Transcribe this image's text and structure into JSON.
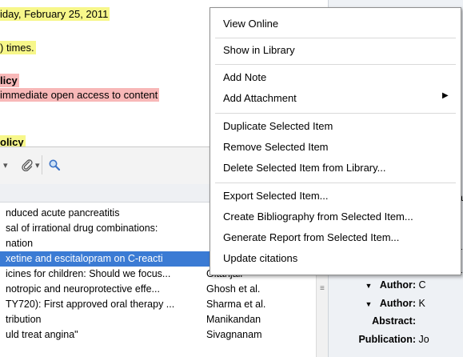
{
  "document": {
    "lines": [
      {
        "text": "iday, February 25, 2011",
        "style": "yellow"
      },
      {
        "text": ") times.",
        "style": "yellow"
      },
      {
        "text": "licy",
        "style": "pink-bold"
      },
      {
        "text": "immediate open access to content",
        "style": "pink"
      },
      {
        "text": "olicy",
        "style": "yellow-bold"
      }
    ]
  },
  "toolbar": {
    "attach_icon": "paperclip-icon",
    "search_icon": "magnifier-icon"
  },
  "items": [
    {
      "title": "nduced acute pancreatitis",
      "creator": ""
    },
    {
      "title": "sal of irrational drug combinations:",
      "creator": ""
    },
    {
      "title": "nation",
      "creator": ""
    },
    {
      "title": "xetine and escitalopram on C-reacti",
      "creator": "",
      "selected": true
    },
    {
      "title": "icines for children: Should we focus...",
      "creator": "Gitanjali"
    },
    {
      "title": "notropic and neuroprotective effe...",
      "creator": "Ghosh et al."
    },
    {
      "title": "TY720): First approved oral therapy ...",
      "creator": "Sharma et al."
    },
    {
      "title": "tribution",
      "creator": "Manikandan"
    },
    {
      "title": "uld treat angina\"",
      "creator": "Sivagnanam"
    }
  ],
  "context_menu": {
    "items": [
      {
        "label": "View Online"
      },
      {
        "label": "Show in Library"
      },
      {
        "label": "Add Note"
      },
      {
        "label": "Add Attachment",
        "submenu": true
      },
      {
        "label": "Duplicate Selected Item"
      },
      {
        "label": "Remove Selected Item"
      },
      {
        "label": "Delete Selected Item from Library..."
      },
      {
        "label": "Export Selected Item..."
      },
      {
        "label": "Create Bibliography from Selected Item..."
      },
      {
        "label": "Generate Report from Selected Item..."
      },
      {
        "label": "Update citations"
      }
    ]
  },
  "info_pane": {
    "fragments": [
      "a",
      "c",
      "a",
      "a"
    ],
    "fields": [
      {
        "label": "Author:",
        "value": "C",
        "expandable": true
      },
      {
        "label": "Author:",
        "value": "K",
        "expandable": true
      },
      {
        "label": "Abstract:",
        "value": ""
      },
      {
        "label": "Publication:",
        "value": "Jo"
      }
    ]
  },
  "colors": {
    "highlight_yellow": "#f7f78a",
    "highlight_pink": "#f8b8b8",
    "selection_blue": "#3b7bd4"
  }
}
